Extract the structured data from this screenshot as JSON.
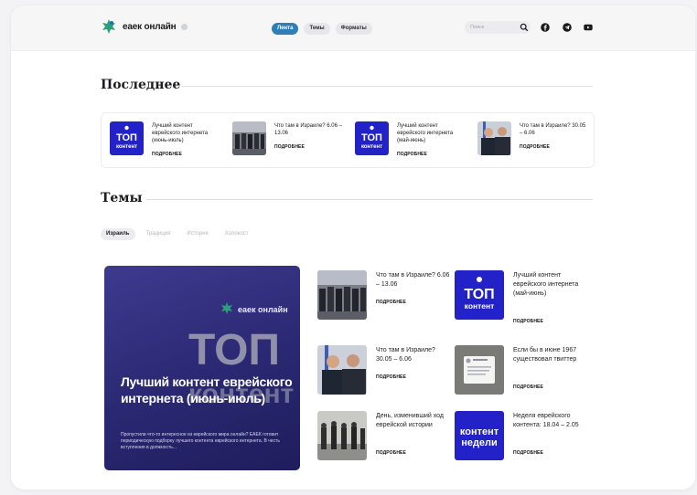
{
  "header": {
    "logo_text": "еаек онлайн",
    "nav": [
      {
        "label": "Лента",
        "active": true
      },
      {
        "label": "Темы",
        "active": false
      },
      {
        "label": "Форматы",
        "active": false
      }
    ],
    "search_placeholder": "Поиск",
    "icons": [
      "search-icon",
      "facebook-icon",
      "telegram-icon",
      "youtube-icon"
    ]
  },
  "latest": {
    "title": "Последнее",
    "more_label": "ПОДРОБНЕЕ",
    "items": [
      {
        "title": "Лучший контент еврейского интернета (июнь-июль)",
        "thumb": "top-content"
      },
      {
        "title": "Что там в Израиле? 6.06 – 13.06",
        "thumb": "knesset-photo"
      },
      {
        "title": "Лучший контент еврейского интернета (май-июнь)",
        "thumb": "top-content"
      },
      {
        "title": "Что там в Израиле? 30.05 – 6.06",
        "thumb": "politicians-photo"
      }
    ]
  },
  "topics": {
    "title": "Темы",
    "chips": [
      {
        "label": "Израиль",
        "active": true
      },
      {
        "label": "Традиция",
        "active": false
      },
      {
        "label": "История",
        "active": false
      },
      {
        "label": "Холокост",
        "active": false
      }
    ],
    "hero": {
      "logo_text": "еаек онлайн",
      "big_word_1": "ТОП",
      "big_word_2": "контент",
      "title": "Лучший контент еврейского интернета (июнь-июль)",
      "description": "Пропустили что-то интересное из еврейского мира онлайн? ЕАЕК готовит периодическую подборку лучшего контента еврейского интернета. В честь вступления в должность..."
    },
    "more_label": "ПОДРОБНЕЕ",
    "cards": [
      {
        "title": "Что там в Израиле? 6.06 – 13.06",
        "thumb": "knesset-photo"
      },
      {
        "title": "Лучший контент еврейского интернета (май-июнь)",
        "thumb": "top-content"
      },
      {
        "title": "Что там в Израиле? 30.05 – 6.06",
        "thumb": "politicians-photo"
      },
      {
        "title": "Если бы в июне 1967 существовал твиттер",
        "thumb": "tweet-photo"
      },
      {
        "title": "День, изменивший ход еврейской истории",
        "thumb": "soldiers-photo"
      },
      {
        "title": "Неделя еврейского контента: 18.04 – 2.05",
        "thumb": "week-content"
      }
    ]
  },
  "thumb_text": {
    "top_1": "ТОП",
    "top_2": "контент",
    "week_1": "контент",
    "week_2": "недели"
  },
  "colors": {
    "accent_blue": "#2c7fb8",
    "tile_blue": "#2222c8",
    "hero_purple": "#2a2872",
    "logo_green": "#2aa07a"
  }
}
